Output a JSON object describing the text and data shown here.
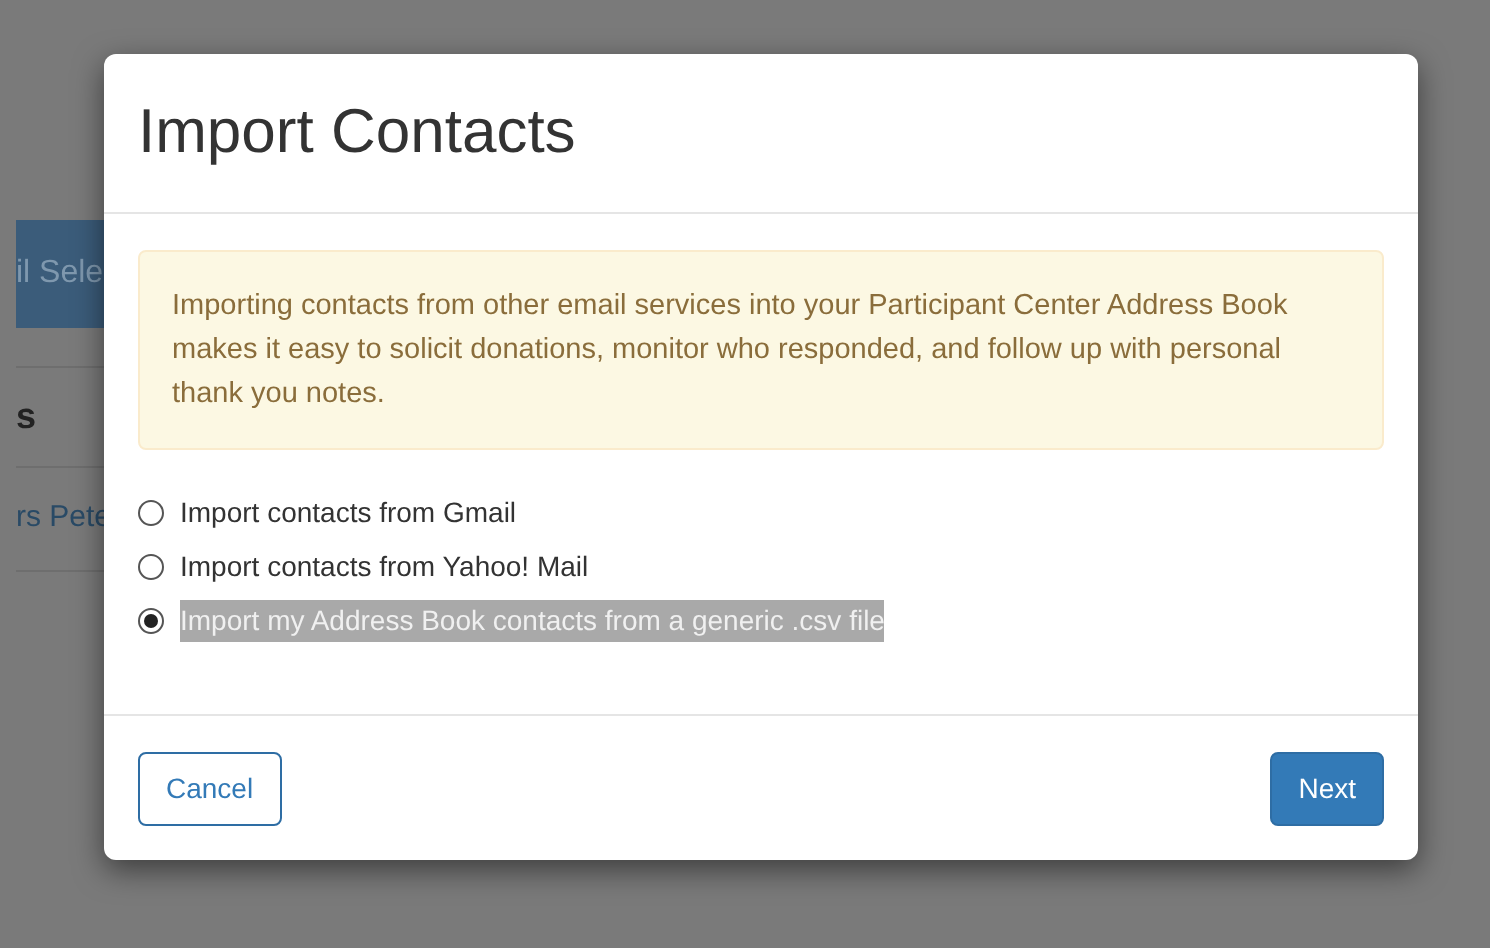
{
  "background": {
    "button": "il Sele",
    "heading": "s",
    "link": "rs Pete"
  },
  "modal": {
    "title": "Import Contacts",
    "notice": "Importing contacts from other email services into your Participant Center Address Book makes it easy to solicit donations, monitor who responded, and follow up with personal thank you notes.",
    "options": [
      {
        "label": "Import contacts from Gmail",
        "selected": false
      },
      {
        "label": "Import contacts from Yahoo! Mail",
        "selected": false
      },
      {
        "label": "Import my Address Book contacts from a generic .csv file",
        "selected": true
      }
    ],
    "buttons": {
      "cancel": "Cancel",
      "next": "Next"
    }
  }
}
